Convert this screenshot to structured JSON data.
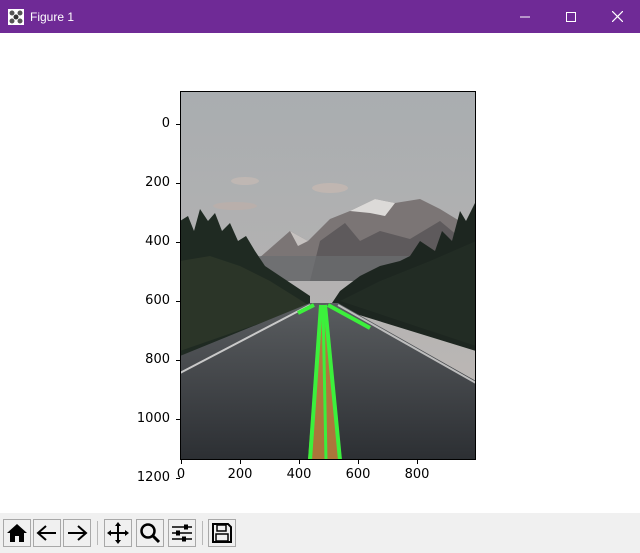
{
  "window": {
    "title": "Figure 1",
    "icons": [
      "app-icon",
      "minimize-icon",
      "maximize-icon",
      "close-icon"
    ]
  },
  "plot": {
    "image_description_type": "road-mountain-photo-with-green-lane-lines",
    "y_ticks": [
      "0",
      "200",
      "400",
      "600",
      "800",
      "1000",
      "1200"
    ],
    "x_ticks": [
      "0",
      "200",
      "400",
      "600",
      "800"
    ],
    "colors": {
      "lane_line": "#3cf03c",
      "lane_fill": "#c2813c"
    }
  },
  "toolbar": {
    "buttons": [
      "home-icon",
      "back-icon",
      "forward-icon",
      "pan-icon",
      "zoom-icon",
      "configure-subplots-icon",
      "save-icon"
    ]
  }
}
